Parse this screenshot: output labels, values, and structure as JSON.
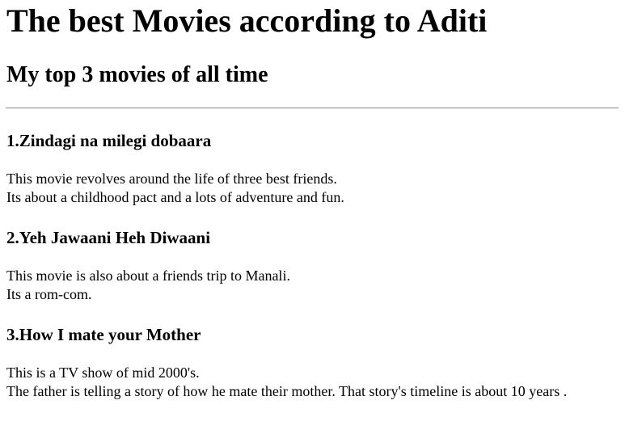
{
  "title": "The best Movies according to Aditi",
  "subtitle": "My top 3 movies of all time",
  "movies": [
    {
      "heading": "1.Zindagi na milegi dobaara",
      "lines": [
        "This movie revolves around the life of three best friends.",
        "Its about a childhood pact and a lots of adventure and fun."
      ]
    },
    {
      "heading": "2.Yeh Jawaani Heh Diwaani",
      "lines": [
        "This movie is also about a friends trip to Manali.",
        "Its a rom-com."
      ]
    },
    {
      "heading": "3.How I mate your Mother",
      "lines": [
        "This is a TV show of mid 2000's.",
        "The father is telling a story of how he mate their mother. That story's timeline is about 10 years ."
      ]
    }
  ]
}
